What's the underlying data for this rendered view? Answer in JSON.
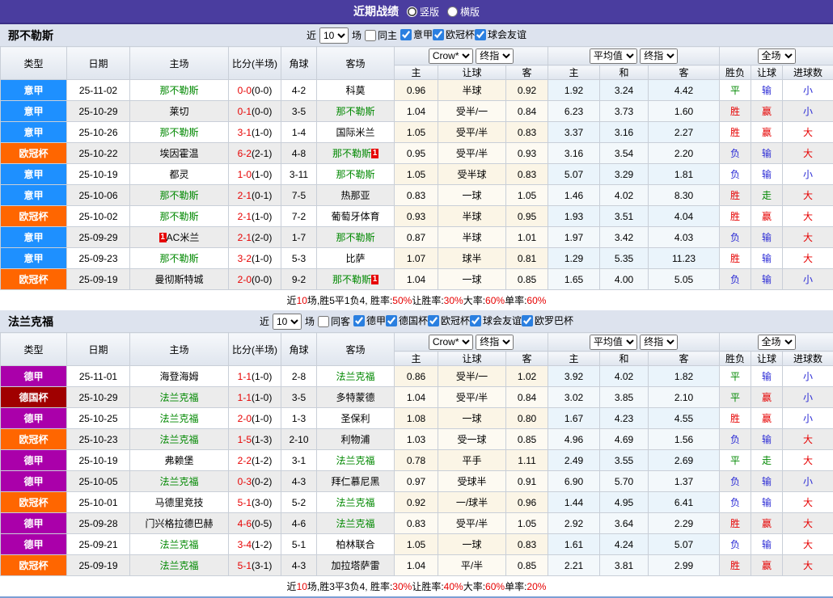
{
  "titlebar": {
    "title": "近期战绩",
    "radio_vertical": "竖版",
    "radio_horizontal": "横版"
  },
  "colors": {
    "accent_purple": "#4a3d9f",
    "red": "#e60000",
    "green": "#008800",
    "blue": "#2b2bd5"
  },
  "league_colors": {
    "意甲": "#1e90ff",
    "欧冠杯": "#ff6600",
    "德甲": "#aa00aa",
    "德国杯": "#a00000"
  },
  "result_color_map": {
    "胜": "t-red",
    "平": "t-green",
    "负": "t-blue",
    "赢": "t-red",
    "走": "t-green",
    "输": "t-blue",
    "大": "t-red",
    "小": "t-blue"
  },
  "table_headers": {
    "cols": [
      "类型",
      "日期",
      "主场",
      "比分(半场)",
      "角球",
      "客场"
    ],
    "odds_select_1": "Crow*",
    "odds_select_2": "终指",
    "avg_select_1": "平均值",
    "avg_select_2": "终指",
    "scope_select": "全场",
    "sub": [
      "主",
      "让球",
      "客",
      "主",
      "和",
      "客",
      "胜负",
      "让球",
      "进球数"
    ]
  },
  "sections": [
    {
      "team": "那不勒斯",
      "filters": {
        "near_label": "近",
        "games_value": "10",
        "games_unit": "场",
        "same_label": "同主",
        "same_checked": false,
        "leagues": [
          "意甲",
          "欧冠杯",
          "球会友谊"
        ]
      },
      "rows": [
        {
          "league": "意甲",
          "date": "25-11-02",
          "home": "那不勒斯",
          "home_hl": true,
          "home_badge": null,
          "score": "0-0",
          "half": "(0-0)",
          "corner": "4-2",
          "away": "科莫",
          "away_hl": false,
          "away_badge": null,
          "let": [
            "0.96",
            "半球",
            "0.92"
          ],
          "avg": [
            "1.92",
            "3.24",
            "4.42"
          ],
          "res": [
            "平",
            "输",
            "小"
          ]
        },
        {
          "league": "意甲",
          "date": "25-10-29",
          "home": "莱切",
          "home_hl": false,
          "home_badge": null,
          "score": "0-1",
          "half": "(0-0)",
          "corner": "3-5",
          "away": "那不勒斯",
          "away_hl": true,
          "away_badge": null,
          "let": [
            "1.04",
            "受半/一",
            "0.84"
          ],
          "avg": [
            "6.23",
            "3.73",
            "1.60"
          ],
          "res": [
            "胜",
            "赢",
            "小"
          ]
        },
        {
          "league": "意甲",
          "date": "25-10-26",
          "home": "那不勒斯",
          "home_hl": true,
          "home_badge": null,
          "score": "3-1",
          "half": "(1-0)",
          "corner": "1-4",
          "away": "国际米兰",
          "away_hl": false,
          "away_badge": null,
          "let": [
            "1.05",
            "受平/半",
            "0.83"
          ],
          "avg": [
            "3.37",
            "3.16",
            "2.27"
          ],
          "res": [
            "胜",
            "赢",
            "大"
          ]
        },
        {
          "league": "欧冠杯",
          "date": "25-10-22",
          "home": "埃因霍温",
          "home_hl": false,
          "home_badge": null,
          "score": "6-2",
          "half": "(2-1)",
          "corner": "4-8",
          "away": "那不勒斯",
          "away_hl": true,
          "away_badge": "1",
          "let": [
            "0.95",
            "受平/半",
            "0.93"
          ],
          "avg": [
            "3.16",
            "3.54",
            "2.20"
          ],
          "res": [
            "负",
            "输",
            "大"
          ]
        },
        {
          "league": "意甲",
          "date": "25-10-19",
          "home": "都灵",
          "home_hl": false,
          "home_badge": null,
          "score": "1-0",
          "half": "(1-0)",
          "corner": "3-11",
          "away": "那不勒斯",
          "away_hl": true,
          "away_badge": null,
          "let": [
            "1.05",
            "受半球",
            "0.83"
          ],
          "avg": [
            "5.07",
            "3.29",
            "1.81"
          ],
          "res": [
            "负",
            "输",
            "小"
          ]
        },
        {
          "league": "意甲",
          "date": "25-10-06",
          "home": "那不勒斯",
          "home_hl": true,
          "home_badge": null,
          "score": "2-1",
          "half": "(0-1)",
          "corner": "7-5",
          "away": "热那亚",
          "away_hl": false,
          "away_badge": null,
          "let": [
            "0.83",
            "一球",
            "1.05"
          ],
          "avg": [
            "1.46",
            "4.02",
            "8.30"
          ],
          "res": [
            "胜",
            "走",
            "大"
          ]
        },
        {
          "league": "欧冠杯",
          "date": "25-10-02",
          "home": "那不勒斯",
          "home_hl": true,
          "home_badge": null,
          "score": "2-1",
          "half": "(1-0)",
          "corner": "7-2",
          "away": "葡萄牙体育",
          "away_hl": false,
          "away_badge": null,
          "let": [
            "0.93",
            "半球",
            "0.95"
          ],
          "avg": [
            "1.93",
            "3.51",
            "4.04"
          ],
          "res": [
            "胜",
            "赢",
            "大"
          ]
        },
        {
          "league": "意甲",
          "date": "25-09-29",
          "home": "AC米兰",
          "home_hl": false,
          "home_badge": "1",
          "score": "2-1",
          "half": "(2-0)",
          "corner": "1-7",
          "away": "那不勒斯",
          "away_hl": true,
          "away_badge": null,
          "let": [
            "0.87",
            "半球",
            "1.01"
          ],
          "avg": [
            "1.97",
            "3.42",
            "4.03"
          ],
          "res": [
            "负",
            "输",
            "大"
          ]
        },
        {
          "league": "意甲",
          "date": "25-09-23",
          "home": "那不勒斯",
          "home_hl": true,
          "home_badge": null,
          "score": "3-2",
          "half": "(1-0)",
          "corner": "5-3",
          "away": "比萨",
          "away_hl": false,
          "away_badge": null,
          "let": [
            "1.07",
            "球半",
            "0.81"
          ],
          "avg": [
            "1.29",
            "5.35",
            "11.23"
          ],
          "res": [
            "胜",
            "输",
            "大"
          ]
        },
        {
          "league": "欧冠杯",
          "date": "25-09-19",
          "home": "曼彻斯特城",
          "home_hl": false,
          "home_badge": null,
          "score": "2-0",
          "half": "(0-0)",
          "corner": "9-2",
          "away": "那不勒斯",
          "away_hl": true,
          "away_badge": "1",
          "let": [
            "1.04",
            "一球",
            "0.85"
          ],
          "avg": [
            "1.65",
            "4.00",
            "5.05"
          ],
          "res": [
            "负",
            "输",
            "小"
          ]
        }
      ],
      "summary_segments": [
        [
          "近",
          "k"
        ],
        [
          "10",
          "r"
        ],
        [
          "场,胜5平1负4, 胜率:",
          "k"
        ],
        [
          "50%",
          "r"
        ],
        [
          " 让胜率:",
          "k"
        ],
        [
          "30%",
          "r"
        ],
        [
          " 大率:",
          "k"
        ],
        [
          "60%",
          "r"
        ],
        [
          " 单率:",
          "k"
        ],
        [
          "60%",
          "r"
        ]
      ]
    },
    {
      "team": "法兰克福",
      "filters": {
        "near_label": "近",
        "games_value": "10",
        "games_unit": "场",
        "same_label": "同客",
        "same_checked": false,
        "leagues": [
          "德甲",
          "德国杯",
          "欧冠杯",
          "球会友谊",
          "欧罗巴杯"
        ]
      },
      "rows": [
        {
          "league": "德甲",
          "date": "25-11-01",
          "home": "海登海姆",
          "home_hl": false,
          "home_badge": null,
          "score": "1-1",
          "half": "(1-0)",
          "corner": "2-8",
          "away": "法兰克福",
          "away_hl": true,
          "away_badge": null,
          "let": [
            "0.86",
            "受半/一",
            "1.02"
          ],
          "avg": [
            "3.92",
            "4.02",
            "1.82"
          ],
          "res": [
            "平",
            "输",
            "小"
          ]
        },
        {
          "league": "德国杯",
          "date": "25-10-29",
          "home": "法兰克福",
          "home_hl": true,
          "home_badge": null,
          "score": "1-1",
          "half": "(1-0)",
          "corner": "3-5",
          "away": "多特蒙德",
          "away_hl": false,
          "away_badge": null,
          "let": [
            "1.04",
            "受平/半",
            "0.84"
          ],
          "avg": [
            "3.02",
            "3.85",
            "2.10"
          ],
          "res": [
            "平",
            "赢",
            "小"
          ]
        },
        {
          "league": "德甲",
          "date": "25-10-25",
          "home": "法兰克福",
          "home_hl": true,
          "home_badge": null,
          "score": "2-0",
          "half": "(1-0)",
          "corner": "1-3",
          "away": "圣保利",
          "away_hl": false,
          "away_badge": null,
          "let": [
            "1.08",
            "一球",
            "0.80"
          ],
          "avg": [
            "1.67",
            "4.23",
            "4.55"
          ],
          "res": [
            "胜",
            "赢",
            "小"
          ]
        },
        {
          "league": "欧冠杯",
          "date": "25-10-23",
          "home": "法兰克福",
          "home_hl": true,
          "home_badge": null,
          "score": "1-5",
          "half": "(1-3)",
          "corner": "2-10",
          "away": "利物浦",
          "away_hl": false,
          "away_badge": null,
          "let": [
            "1.03",
            "受一球",
            "0.85"
          ],
          "avg": [
            "4.96",
            "4.69",
            "1.56"
          ],
          "res": [
            "负",
            "输",
            "大"
          ]
        },
        {
          "league": "德甲",
          "date": "25-10-19",
          "home": "弗赖堡",
          "home_hl": false,
          "home_badge": null,
          "score": "2-2",
          "half": "(1-2)",
          "corner": "3-1",
          "away": "法兰克福",
          "away_hl": true,
          "away_badge": null,
          "let": [
            "0.78",
            "平手",
            "1.11"
          ],
          "avg": [
            "2.49",
            "3.55",
            "2.69"
          ],
          "res": [
            "平",
            "走",
            "大"
          ]
        },
        {
          "league": "德甲",
          "date": "25-10-05",
          "home": "法兰克福",
          "home_hl": true,
          "home_badge": null,
          "score": "0-3",
          "half": "(0-2)",
          "corner": "4-3",
          "away": "拜仁慕尼黑",
          "away_hl": false,
          "away_badge": null,
          "let": [
            "0.97",
            "受球半",
            "0.91"
          ],
          "avg": [
            "6.90",
            "5.70",
            "1.37"
          ],
          "res": [
            "负",
            "输",
            "小"
          ]
        },
        {
          "league": "欧冠杯",
          "date": "25-10-01",
          "home": "马德里竞技",
          "home_hl": false,
          "home_badge": null,
          "score": "5-1",
          "half": "(3-0)",
          "corner": "5-2",
          "away": "法兰克福",
          "away_hl": true,
          "away_badge": null,
          "let": [
            "0.92",
            "一/球半",
            "0.96"
          ],
          "avg": [
            "1.44",
            "4.95",
            "6.41"
          ],
          "res": [
            "负",
            "输",
            "大"
          ]
        },
        {
          "league": "德甲",
          "date": "25-09-28",
          "home": "门兴格拉德巴赫",
          "home_hl": false,
          "home_badge": null,
          "score": "4-6",
          "half": "(0-5)",
          "corner": "4-6",
          "away": "法兰克福",
          "away_hl": true,
          "away_badge": null,
          "let": [
            "0.83",
            "受平/半",
            "1.05"
          ],
          "avg": [
            "2.92",
            "3.64",
            "2.29"
          ],
          "res": [
            "胜",
            "赢",
            "大"
          ]
        },
        {
          "league": "德甲",
          "date": "25-09-21",
          "home": "法兰克福",
          "home_hl": true,
          "home_badge": null,
          "score": "3-4",
          "half": "(1-2)",
          "corner": "5-1",
          "away": "柏林联合",
          "away_hl": false,
          "away_badge": null,
          "let": [
            "1.05",
            "一球",
            "0.83"
          ],
          "avg": [
            "1.61",
            "4.24",
            "5.07"
          ],
          "res": [
            "负",
            "输",
            "大"
          ]
        },
        {
          "league": "欧冠杯",
          "date": "25-09-19",
          "home": "法兰克福",
          "home_hl": true,
          "home_badge": null,
          "score": "5-1",
          "half": "(3-1)",
          "corner": "4-3",
          "away": "加拉塔萨雷",
          "away_hl": false,
          "away_badge": null,
          "let": [
            "1.04",
            "平/半",
            "0.85"
          ],
          "avg": [
            "2.21",
            "3.81",
            "2.99"
          ],
          "res": [
            "胜",
            "赢",
            "大"
          ]
        }
      ],
      "summary_segments": [
        [
          "近",
          "k"
        ],
        [
          "10",
          "r"
        ],
        [
          "场,胜3平3负4, 胜率:",
          "k"
        ],
        [
          "30%",
          "r"
        ],
        [
          " 让胜率:",
          "k"
        ],
        [
          "40%",
          "r"
        ],
        [
          " 大率:",
          "k"
        ],
        [
          "60%",
          "r"
        ],
        [
          " 单率:",
          "k"
        ],
        [
          "20%",
          "r"
        ]
      ]
    }
  ]
}
